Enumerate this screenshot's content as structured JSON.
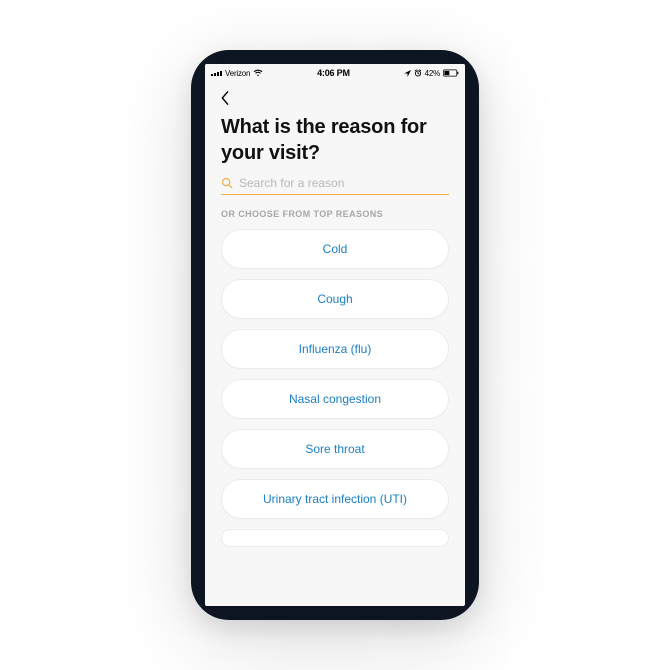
{
  "status": {
    "carrier": "Verizon",
    "time": "4:06 PM",
    "battery": "42%"
  },
  "header": {
    "title": "What is the reason for your visit?"
  },
  "search": {
    "placeholder": "Search for a reason"
  },
  "section_label": "OR CHOOSE FROM TOP REASONS",
  "reasons": [
    {
      "label": "Cold"
    },
    {
      "label": "Cough"
    },
    {
      "label": "Influenza (flu)"
    },
    {
      "label": "Nasal congestion"
    },
    {
      "label": "Sore throat"
    },
    {
      "label": "Urinary tract infection (UTI)"
    }
  ]
}
